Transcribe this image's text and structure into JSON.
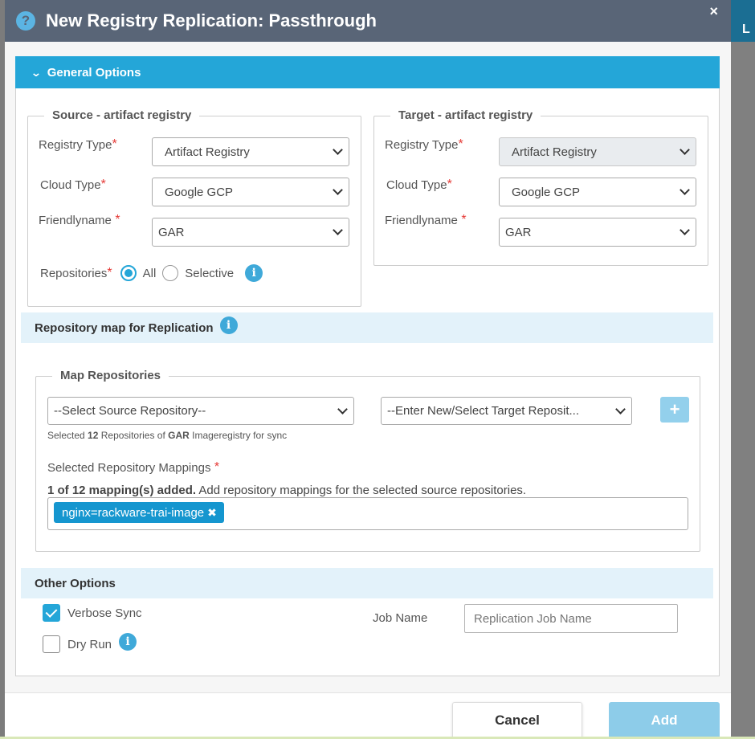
{
  "background": {
    "edge_label": "L"
  },
  "dialog": {
    "help_icon": "?",
    "title": "New Registry Replication: Passthrough",
    "close_glyph": "×"
  },
  "general_options": {
    "title": "General Options"
  },
  "source": {
    "legend": "Source - artifact registry",
    "registry_type_label": "Registry Type",
    "registry_type_value": "Artifact Registry",
    "cloud_type_label": "Cloud Type",
    "cloud_type_value": "Google GCP",
    "friendlyname_label": "Friendlyname",
    "friendlyname_value": "GAR",
    "repositories_label": "Repositories",
    "option_all": "All",
    "option_selective": "Selective",
    "selected_option": "All"
  },
  "target": {
    "legend": "Target - artifact registry",
    "registry_type_label": "Registry Type",
    "registry_type_value": "Artifact Registry",
    "cloud_type_label": "Cloud Type",
    "cloud_type_value": "Google GCP",
    "friendlyname_label": "Friendlyname",
    "friendlyname_value": "GAR"
  },
  "repo_map": {
    "title": "Repository map for Replication",
    "legend": "Map Repositories",
    "source_select": "--Select Source Repository--",
    "target_select": "--Enter New/Select Target Reposit...",
    "add_symbol": "+",
    "hint_pre": "Selected ",
    "hint_count": "12",
    "hint_mid": " Repositories of ",
    "hint_registry": "GAR",
    "hint_post": " Imageregistry for sync",
    "mappings_label": "Selected Repository Mappings",
    "mappings_status_bold": "1 of 12 mapping(s) added.",
    "mappings_status_text": " Add repository mappings for the selected source repositories.",
    "mappings": [
      "nginx=rackware-trai-image"
    ],
    "tag_remove_glyph": "✖"
  },
  "other_options": {
    "title": "Other Options",
    "verbose_sync_label": "Verbose Sync",
    "verbose_sync_checked": true,
    "dry_run_label": "Dry Run",
    "dry_run_checked": false,
    "job_name_label": "Job Name",
    "job_name_placeholder": "Replication Job Name",
    "job_name_value": ""
  },
  "common": {
    "required_marker": "*",
    "info_glyph": "i"
  },
  "footer": {
    "cancel_label": "Cancel",
    "add_label": "Add"
  },
  "colors": {
    "accent": "#24a6d8",
    "header": "#596577",
    "band": "#e3f2fa",
    "required": "#e53935"
  }
}
